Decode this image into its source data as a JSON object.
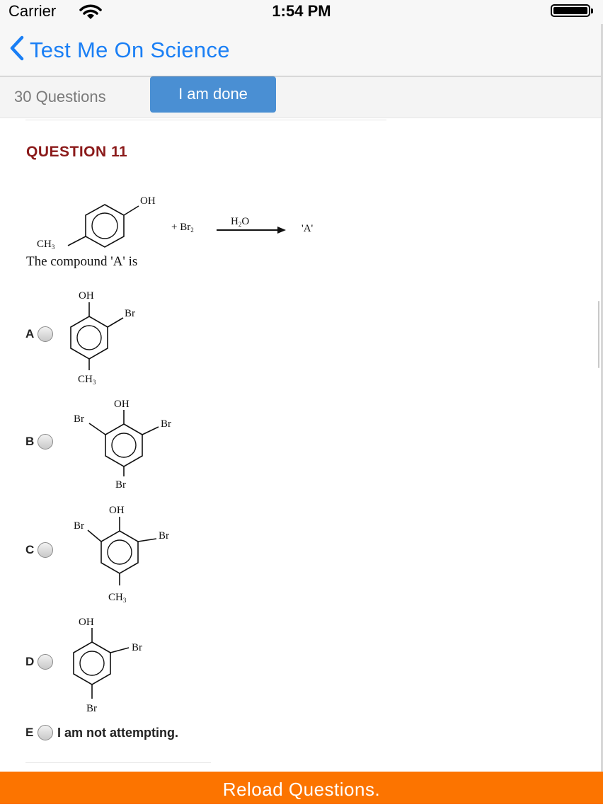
{
  "status_bar": {
    "carrier": "Carrier",
    "time": "1:54 PM"
  },
  "nav": {
    "back_title": "Test Me On Science"
  },
  "toolbar": {
    "question_count": "30 Questions",
    "done_label": "I am done"
  },
  "question": {
    "title": "QUESTION 11",
    "figure": {
      "oh": "OH",
      "ch3": "CH",
      "ch3_sub": "3",
      "plus": "+ Br",
      "plus_sub": "2",
      "reagent": "H",
      "reagent_sub": "2",
      "reagent_o": "O",
      "product": "'A'"
    },
    "text": "The compound 'A' is"
  },
  "options": [
    {
      "letter": "A",
      "labels": {
        "top": "OH",
        "right": "Br",
        "bottom": "CH",
        "bottom_sub": "3"
      }
    },
    {
      "letter": "B",
      "labels": {
        "top": "OH",
        "left": "Br",
        "right": "Br",
        "bottom": "Br"
      }
    },
    {
      "letter": "C",
      "labels": {
        "top": "OH",
        "left": "Br",
        "right": "Br",
        "bottom": "CH",
        "bottom_sub": "3"
      }
    },
    {
      "letter": "D",
      "labels": {
        "top": "OH",
        "right": "Br",
        "bottom": "Br"
      }
    },
    {
      "letter": "E",
      "text": "I am not attempting."
    }
  ],
  "footer": {
    "reload_label": "Reload Questions."
  },
  "colors": {
    "accent": "#1a7ff5",
    "done_button": "#4a8fd3",
    "question_title": "#8b1a1a",
    "reload_bar": "#fc7400"
  }
}
